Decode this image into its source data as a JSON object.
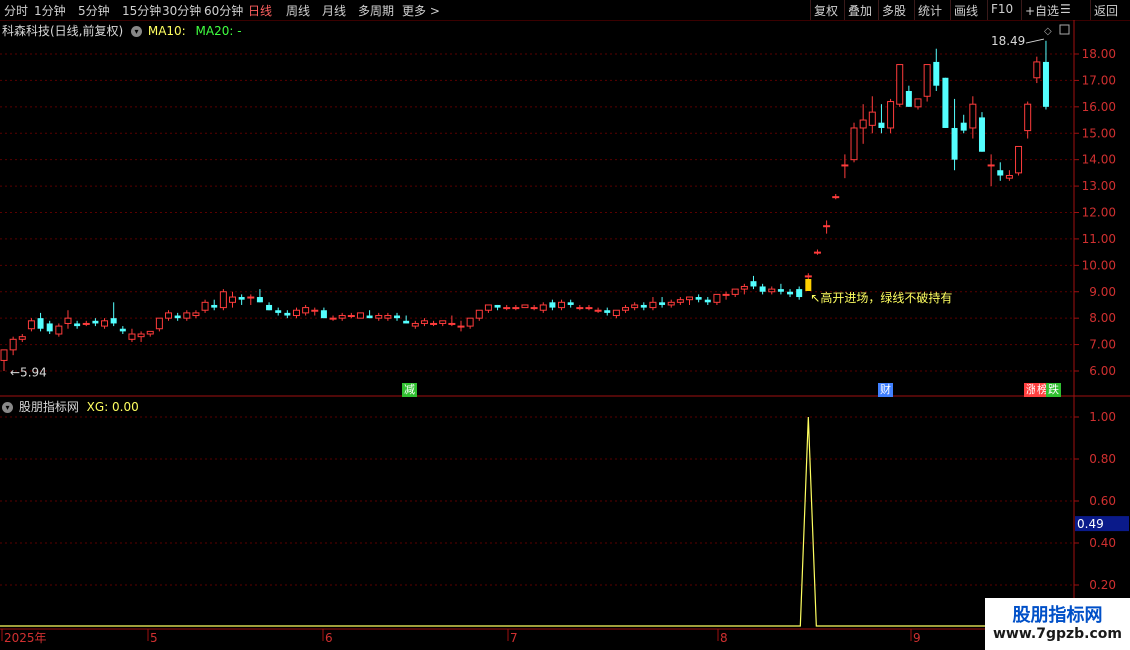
{
  "toolbar": {
    "left": [
      "分时",
      "1分钟",
      "5分钟",
      "15分钟",
      "30分钟",
      "60分钟",
      "日线",
      "周线",
      "月线",
      "多周期",
      "更多 >"
    ],
    "active_index": 6,
    "right": [
      "复权",
      "叠加",
      "多股",
      "统计",
      "画线",
      "F10",
      "+自选",
      "返回"
    ]
  },
  "stock": {
    "title": "科森科技(日线,前复权)",
    "ma10_label": "MA10:",
    "ma20_label": "MA20: -"
  },
  "price_chart": {
    "high_label": "18.49",
    "low_label": "5.94",
    "annotation": "高开进场，绿线不破持有",
    "y_ticks": [
      "18.00",
      "17.00",
      "16.00",
      "15.00",
      "14.00",
      "13.00",
      "12.00",
      "11.00",
      "10.00",
      "9.00",
      "8.00",
      "7.00",
      "6.00"
    ],
    "tags": [
      {
        "text": "减",
        "color": "#30c030"
      },
      {
        "text": "财",
        "color": "#4080ff"
      },
      {
        "text": "涨",
        "color": "#ff4040"
      },
      {
        "text": "榜",
        "color": "#ff4040"
      },
      {
        "text": "跌",
        "color": "#30c030"
      }
    ]
  },
  "indicator": {
    "name": "股朋指标网",
    "xg_label": "XG: 0.00",
    "y_ticks": [
      "1.00",
      "0.80",
      "0.60",
      "0.40",
      "0.20"
    ],
    "cursor_value": "0.49"
  },
  "x_axis": {
    "labels": [
      "2025年",
      "5",
      "6",
      "7",
      "8",
      "9"
    ]
  },
  "watermark": {
    "title": "股朋指标网",
    "url": "www.7gpzb.com"
  },
  "colors": {
    "up": "#ff3c3c",
    "down": "#54ffff",
    "grid": "#5a0000",
    "axis": "#a01010",
    "signal": "#ffff60",
    "signal_bar": "#ffd000"
  },
  "chart_data": {
    "type": "candlestick",
    "price_range": [
      5.5,
      18.6
    ],
    "candles": [
      [
        6.4,
        6.8,
        6.0,
        6.8
      ],
      [
        6.8,
        7.3,
        6.6,
        7.2
      ],
      [
        7.2,
        7.4,
        7.1,
        7.3
      ],
      [
        7.6,
        8.0,
        7.5,
        7.9
      ],
      [
        8.0,
        8.2,
        7.5,
        7.6
      ],
      [
        7.8,
        7.9,
        7.4,
        7.5
      ],
      [
        7.4,
        7.8,
        7.3,
        7.7
      ],
      [
        7.8,
        8.3,
        7.6,
        8.0
      ],
      [
        7.8,
        7.9,
        7.6,
        7.7
      ],
      [
        7.8,
        7.9,
        7.7,
        7.8
      ],
      [
        7.9,
        8.0,
        7.7,
        7.8
      ],
      [
        7.7,
        8.0,
        7.6,
        7.9
      ],
      [
        8.0,
        8.6,
        7.7,
        7.8
      ],
      [
        7.6,
        7.7,
        7.4,
        7.5
      ],
      [
        7.2,
        7.6,
        7.1,
        7.4
      ],
      [
        7.3,
        7.5,
        7.1,
        7.4
      ],
      [
        7.4,
        7.5,
        7.3,
        7.5
      ],
      [
        7.6,
        8.0,
        7.5,
        8.0
      ],
      [
        8.0,
        8.3,
        7.9,
        8.2
      ],
      [
        8.1,
        8.2,
        7.9,
        8.0
      ],
      [
        8.0,
        8.3,
        7.9,
        8.2
      ],
      [
        8.1,
        8.3,
        8.0,
        8.2
      ],
      [
        8.3,
        8.7,
        8.2,
        8.6
      ],
      [
        8.5,
        8.7,
        8.3,
        8.4
      ],
      [
        8.4,
        9.1,
        8.3,
        9.0
      ],
      [
        8.6,
        9.0,
        8.4,
        8.8
      ],
      [
        8.8,
        8.9,
        8.5,
        8.7
      ],
      [
        8.8,
        8.9,
        8.5,
        8.8
      ],
      [
        8.8,
        9.1,
        8.6,
        8.6
      ],
      [
        8.5,
        8.6,
        8.3,
        8.3
      ],
      [
        8.3,
        8.4,
        8.1,
        8.2
      ],
      [
        8.2,
        8.3,
        8.0,
        8.1
      ],
      [
        8.1,
        8.4,
        8.0,
        8.3
      ],
      [
        8.2,
        8.5,
        8.1,
        8.4
      ],
      [
        8.3,
        8.4,
        8.1,
        8.3
      ],
      [
        8.3,
        8.4,
        8.0,
        8.0
      ],
      [
        8.0,
        8.1,
        7.9,
        8.0
      ],
      [
        8.0,
        8.2,
        7.9,
        8.1
      ],
      [
        8.1,
        8.2,
        8.0,
        8.1
      ],
      [
        8.0,
        8.2,
        8.0,
        8.2
      ],
      [
        8.1,
        8.3,
        8.0,
        8.0
      ],
      [
        8.0,
        8.2,
        7.9,
        8.1
      ],
      [
        8.0,
        8.2,
        7.9,
        8.1
      ],
      [
        8.1,
        8.2,
        7.9,
        8.0
      ],
      [
        7.9,
        8.1,
        7.8,
        7.8
      ],
      [
        7.7,
        7.9,
        7.6,
        7.8
      ],
      [
        7.8,
        8.0,
        7.7,
        7.9
      ],
      [
        7.8,
        7.9,
        7.7,
        7.8
      ],
      [
        7.8,
        7.9,
        7.7,
        7.9
      ],
      [
        7.8,
        8.1,
        7.7,
        7.8
      ],
      [
        7.7,
        7.9,
        7.5,
        7.7
      ],
      [
        7.7,
        8.0,
        7.6,
        8.0
      ],
      [
        8.0,
        8.3,
        7.9,
        8.3
      ],
      [
        8.3,
        8.5,
        8.2,
        8.5
      ],
      [
        8.5,
        8.5,
        8.3,
        8.4
      ],
      [
        8.4,
        8.5,
        8.3,
        8.4
      ],
      [
        8.4,
        8.5,
        8.3,
        8.4
      ],
      [
        8.4,
        8.5,
        8.4,
        8.5
      ],
      [
        8.4,
        8.5,
        8.3,
        8.4
      ],
      [
        8.3,
        8.6,
        8.2,
        8.5
      ],
      [
        8.6,
        8.7,
        8.3,
        8.4
      ],
      [
        8.4,
        8.7,
        8.3,
        8.6
      ],
      [
        8.6,
        8.7,
        8.4,
        8.5
      ],
      [
        8.4,
        8.5,
        8.3,
        8.4
      ],
      [
        8.4,
        8.5,
        8.3,
        8.4
      ],
      [
        8.3,
        8.4,
        8.2,
        8.3
      ],
      [
        8.3,
        8.4,
        8.1,
        8.2
      ],
      [
        8.1,
        8.3,
        8.0,
        8.3
      ],
      [
        8.3,
        8.5,
        8.2,
        8.4
      ],
      [
        8.4,
        8.6,
        8.3,
        8.5
      ],
      [
        8.5,
        8.6,
        8.3,
        8.4
      ],
      [
        8.4,
        8.8,
        8.3,
        8.6
      ],
      [
        8.6,
        8.8,
        8.4,
        8.5
      ],
      [
        8.5,
        8.7,
        8.4,
        8.6
      ],
      [
        8.6,
        8.8,
        8.5,
        8.7
      ],
      [
        8.7,
        8.8,
        8.5,
        8.8
      ],
      [
        8.8,
        8.9,
        8.6,
        8.7
      ],
      [
        8.7,
        8.8,
        8.5,
        8.6
      ],
      [
        8.6,
        8.9,
        8.5,
        8.9
      ],
      [
        8.9,
        9.0,
        8.7,
        8.9
      ],
      [
        8.9,
        9.1,
        8.8,
        9.1
      ],
      [
        9.1,
        9.3,
        8.9,
        9.2
      ],
      [
        9.4,
        9.6,
        9.1,
        9.2
      ],
      [
        9.2,
        9.3,
        8.9,
        9.0
      ],
      [
        9.0,
        9.2,
        8.9,
        9.1
      ],
      [
        9.1,
        9.3,
        8.9,
        9.0
      ],
      [
        9.0,
        9.1,
        8.8,
        8.9
      ],
      [
        9.1,
        9.2,
        8.7,
        8.8
      ],
      [
        9.6,
        9.7,
        9.4,
        9.6
      ],
      [
        10.5,
        10.6,
        10.4,
        10.5
      ],
      [
        11.5,
        11.7,
        11.2,
        11.5
      ],
      [
        12.6,
        12.7,
        12.5,
        12.6
      ],
      [
        13.8,
        14.2,
        13.3,
        13.8
      ],
      [
        14.0,
        15.4,
        13.9,
        15.2
      ],
      [
        15.2,
        16.1,
        14.6,
        15.5
      ],
      [
        15.3,
        16.4,
        15.0,
        15.8
      ],
      [
        15.4,
        16.1,
        15.0,
        15.2
      ],
      [
        15.2,
        16.3,
        15.0,
        16.2
      ],
      [
        16.1,
        17.6,
        16.0,
        17.6
      ],
      [
        16.6,
        16.8,
        16.0,
        16.0
      ],
      [
        16.0,
        16.3,
        15.9,
        16.3
      ],
      [
        16.4,
        17.0,
        16.2,
        17.6
      ],
      [
        17.7,
        18.2,
        16.6,
        16.8
      ],
      [
        17.1,
        17.1,
        15.2,
        15.2
      ],
      [
        15.2,
        16.3,
        13.6,
        14.0
      ],
      [
        15.4,
        15.7,
        15.0,
        15.1
      ],
      [
        15.2,
        16.4,
        14.8,
        16.1
      ],
      [
        15.6,
        15.8,
        14.3,
        14.3
      ],
      [
        13.8,
        14.2,
        13.0,
        13.8
      ],
      [
        13.6,
        13.9,
        13.2,
        13.4
      ],
      [
        13.3,
        13.6,
        13.2,
        13.4
      ],
      [
        13.5,
        14.5,
        13.4,
        14.5
      ],
      [
        15.1,
        16.2,
        14.8,
        16.1
      ],
      [
        17.1,
        17.9,
        16.9,
        17.7
      ],
      [
        17.7,
        18.5,
        15.9,
        16.0
      ]
    ],
    "signal": {
      "candle_index": 88,
      "value": 1.0
    }
  }
}
